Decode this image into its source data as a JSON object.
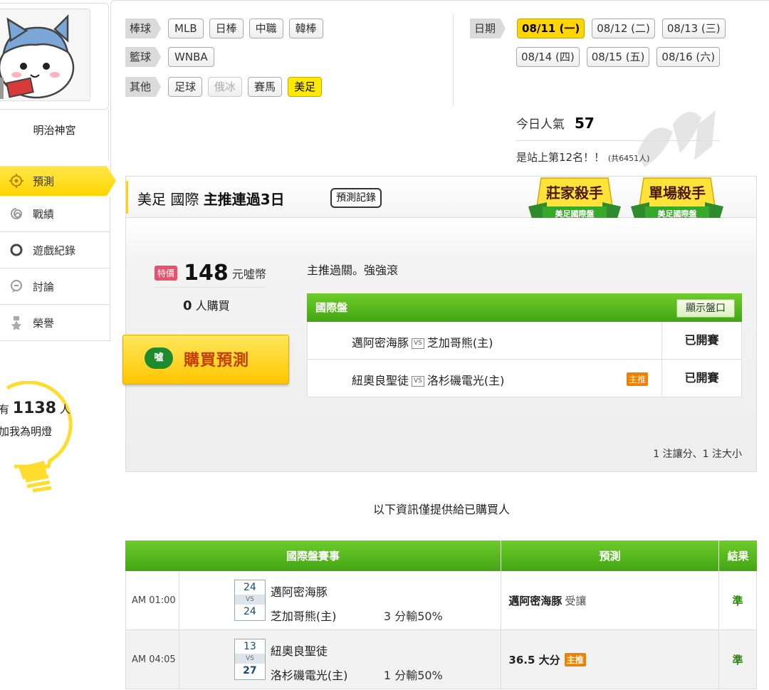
{
  "profile": {
    "username": "明治神宮"
  },
  "menu": [
    {
      "label": "預測",
      "icon": "target-icon",
      "active": true
    },
    {
      "label": "戰績",
      "icon": "swirl-icon",
      "active": false
    },
    {
      "label": "遊戲紀錄",
      "icon": "circle-icon",
      "active": false
    },
    {
      "label": "討論",
      "icon": "chat-icon",
      "active": false
    },
    {
      "label": "榮譽",
      "icon": "medal-icon",
      "active": false
    }
  ],
  "bulb": {
    "prefix": "有",
    "count": "1138",
    "suffix": "人",
    "line2": "加我為明燈"
  },
  "filters": {
    "baseball": {
      "label": "棒球",
      "tags": [
        "MLB",
        "日棒",
        "中職",
        "韓棒"
      ]
    },
    "basketball": {
      "label": "籃球",
      "tags": [
        "WNBA"
      ]
    },
    "other": {
      "label": "其他",
      "tags": [
        "足球",
        "俄冰",
        "賽馬",
        "美足"
      ]
    }
  },
  "dates": {
    "label": "日期",
    "row1": [
      "08/11 (一)",
      "08/12 (二)",
      "08/13 (三)"
    ],
    "row2": [
      "08/14 (四)",
      "08/15 (五)",
      "08/16 (六)"
    ]
  },
  "popularity": {
    "label": "今日人氣",
    "value": "57",
    "rank": "是站上第12名！！",
    "rank_total": "(共6451人)"
  },
  "card": {
    "title_plain": "美足 國際 ",
    "title_bold": "主推連過3日",
    "record_btn": "預測記錄",
    "badge1": {
      "big": "莊家殺手",
      "small": "美足國際盤"
    },
    "badge2": {
      "big": "單場殺手",
      "small": "美足國際盤"
    },
    "special_tag": "特價",
    "price": "148",
    "price_unit": "元噓幣",
    "buyers_count": "0",
    "buyers_label": "人購買",
    "buy_icon": "噓",
    "buy_label": "購買預測",
    "desc": "主推過關。強強滾",
    "intl_title": "國際盤",
    "show_odds": "顯示盤口",
    "games": [
      {
        "away": "邁阿密海豚",
        "home": "芝加哥熊(主)",
        "status": "已開賽",
        "main": false
      },
      {
        "away": "紐奧良聖徒",
        "home": "洛杉磯電光(主)",
        "status": "已開賽",
        "main": true,
        "main_tag": "主推"
      }
    ],
    "vs": "VS",
    "bet_summary": "1 注讓分、1 注大小"
  },
  "purchaser_note": "以下資訊僅提供給已購買人",
  "results": {
    "headers": [
      "國際盤賽事",
      "預測",
      "結果"
    ],
    "rows": [
      {
        "time": "AM 01:00",
        "s1": "24",
        "s2": "24",
        "team1": "邁阿密海豚",
        "team2": "芝加哥熊(主)",
        "spread": "3 分輸50%",
        "pred": "邁阿密海豚",
        "pred_note": "受讓",
        "result": "準"
      },
      {
        "time": "AM 04:05",
        "s1": "13",
        "s2": "27",
        "team1": "紐奧良聖徒",
        "team2": "洛杉磯電光(主)",
        "spread": "1 分輸50%",
        "pred": "36.5 大分",
        "pred_tag": "主推",
        "result": "準"
      }
    ]
  },
  "colors": {
    "accent_yellow": "#ffd400",
    "green": "#43a514",
    "orange": "#f08000",
    "pink": "#e8506e"
  }
}
